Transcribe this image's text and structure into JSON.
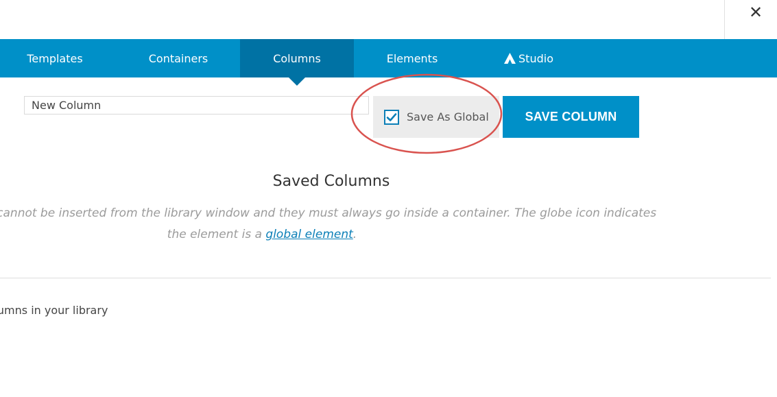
{
  "header": {
    "close_label": "✕"
  },
  "tabs": [
    {
      "label": "Templates",
      "active": false
    },
    {
      "label": "Containers",
      "active": false
    },
    {
      "label": "Columns",
      "active": true
    },
    {
      "label": "Elements",
      "active": false
    },
    {
      "label": "Studio",
      "active": false,
      "icon": "studio-logo-icon"
    }
  ],
  "save_row": {
    "name_value": "New Column",
    "global_label": "Save As Global",
    "global_checked": true,
    "save_button_label": "SAVE COLUMN"
  },
  "saved": {
    "title": "Saved Columns",
    "description_line1": "ed columns. Columns cannot be inserted from the library window and they must always go inside a container. The globe icon indicates",
    "description_line2_prefix": "the element is a ",
    "description_link": "global element",
    "description_line2_suffix": ".",
    "empty_message": "o columns in your library"
  },
  "colors": {
    "tab_bar": "#0090c8",
    "tab_active": "#0072a4",
    "button": "#0090c8",
    "annotation_circle": "#d9534f"
  }
}
